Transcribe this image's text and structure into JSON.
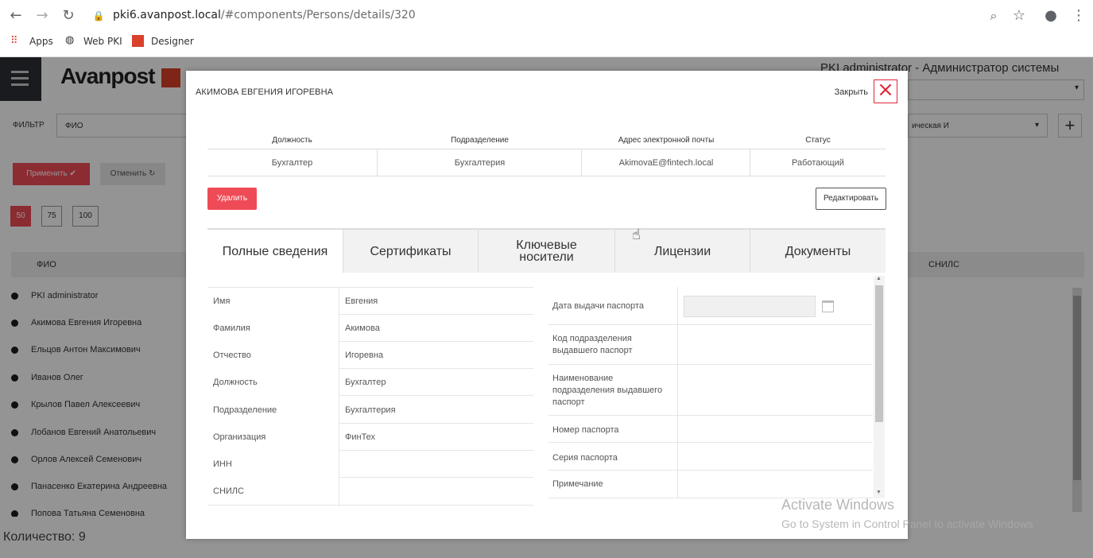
{
  "browser": {
    "url_host": "pki6.avanpost.local",
    "url_path": "/#components/Persons/details/320",
    "bookmarks": [
      "Apps",
      "Web PKI",
      "Designer"
    ]
  },
  "app": {
    "logo": "Avanpost",
    "user": "PKI administrator - Администратор системы",
    "filter_label": "ФИЛЬТР",
    "filter_field": "ФИО",
    "filter_select": "ическая И",
    "apply_label": "Применить ✔",
    "cancel_label": "Отменить ↻",
    "page_sizes": [
      "50",
      "75",
      "100"
    ],
    "col_fio": "ФИО",
    "col_snils": "СНИЛС",
    "rows": [
      "PKI administrator",
      "Акимова Евгения Игоревна",
      "Ельцов Антон Максимович",
      "Иванов Олег",
      "Крылов Павел Алексеевич",
      "Лобанов Евгений Анатольевич",
      "Орлов Алексей Семенович",
      "Панасенко Екатерина Андреевна",
      "Попова Татьяна Семеновна"
    ],
    "count": "Количество: 9"
  },
  "modal": {
    "title": "АКИМОВА ЕВГЕНИЯ ИГОРЕВНА",
    "close_label": "Закрыть",
    "summary": {
      "headers": [
        "Должность",
        "Подразделение",
        "Адрес электронной почты",
        "Статус"
      ],
      "values": [
        "Бухгалтер",
        "Бухгалтерия",
        "AkimovaE@fintech.local",
        "Работающий"
      ]
    },
    "delete_label": "Удалить",
    "edit_label": "Редактировать",
    "tabs": [
      "Полные сведения",
      "Сертификаты",
      "Ключевые носители",
      "Лицензии",
      "Документы"
    ],
    "active_tab": "Полные сведения",
    "left_fields": [
      {
        "label": "Имя",
        "value": "Евгения"
      },
      {
        "label": "Фамилия",
        "value": "Акимова"
      },
      {
        "label": "Отчество",
        "value": "Игоревна"
      },
      {
        "label": "Должность",
        "value": "Бухгалтер"
      },
      {
        "label": "Подразделение",
        "value": "Бухгалтерия"
      },
      {
        "label": "Организация",
        "value": "ФинТех"
      },
      {
        "label": "ИНН",
        "value": ""
      },
      {
        "label": "СНИЛС",
        "value": ""
      }
    ],
    "right_fields": [
      {
        "label": "Дата выдачи паспорта",
        "value": ""
      },
      {
        "label": "Код подразделения выдавшего паспорт",
        "value": ""
      },
      {
        "label": "Наименование подразделения выдавшего паспорт",
        "value": ""
      },
      {
        "label": "Номер паспорта",
        "value": ""
      },
      {
        "label": "Серия паспорта",
        "value": ""
      },
      {
        "label": "Примечание",
        "value": ""
      }
    ]
  },
  "watermark": {
    "line1": "Activate Windows",
    "line2": "Go to System in Control Panel to activate Windows"
  },
  "colors": {
    "accent_red": "#ef4b57",
    "close_red": "#e0283a",
    "app_dark": "#2d3034"
  }
}
